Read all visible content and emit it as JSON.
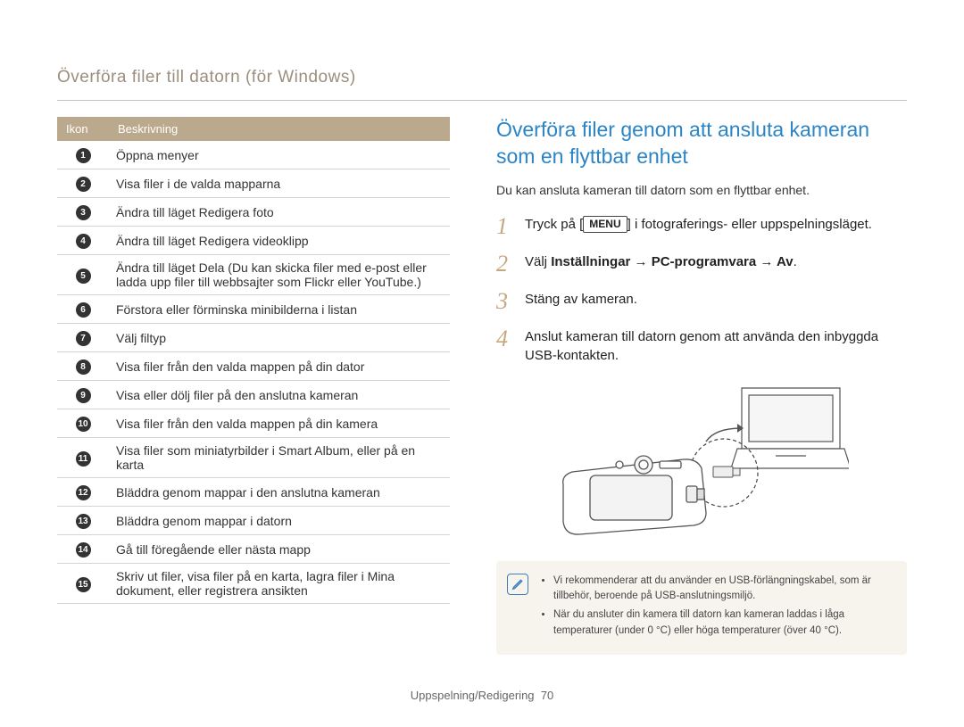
{
  "breadcrumb": "Överföra filer till datorn (för Windows)",
  "table": {
    "headers": {
      "icon": "Ikon",
      "desc": "Beskrivning"
    },
    "rows": [
      {
        "n": "1",
        "desc": "Öppna menyer"
      },
      {
        "n": "2",
        "desc": "Visa filer i de valda mapparna"
      },
      {
        "n": "3",
        "desc": "Ändra till läget Redigera foto"
      },
      {
        "n": "4",
        "desc": "Ändra till läget Redigera videoklipp"
      },
      {
        "n": "5",
        "desc": "Ändra till läget Dela (Du kan skicka filer med e-post eller ladda upp filer till webbsajter som Flickr eller YouTube.)"
      },
      {
        "n": "6",
        "desc": "Förstora eller förminska minibilderna i listan"
      },
      {
        "n": "7",
        "desc": "Välj filtyp"
      },
      {
        "n": "8",
        "desc": "Visa filer från den valda mappen på din dator"
      },
      {
        "n": "9",
        "desc": "Visa eller dölj filer på den anslutna kameran"
      },
      {
        "n": "10",
        "desc": "Visa filer från den valda mappen på din kamera"
      },
      {
        "n": "11",
        "desc": "Visa filer som miniatyrbilder i Smart Album, eller på en karta"
      },
      {
        "n": "12",
        "desc": "Bläddra genom mappar i den anslutna kameran"
      },
      {
        "n": "13",
        "desc": "Bläddra genom mappar i datorn"
      },
      {
        "n": "14",
        "desc": "Gå till föregående eller nästa mapp"
      },
      {
        "n": "15",
        "desc": "Skriv ut filer, visa filer på en karta, lagra filer i Mina dokument, eller registrera ansikten"
      }
    ]
  },
  "section_title": "Överföra filer genom att ansluta kameran som en flyttbar enhet",
  "intro": "Du kan ansluta kameran till datorn som en flyttbar enhet.",
  "steps": [
    {
      "n": "1",
      "pre": "Tryck på [",
      "menu": "MENU",
      "post": "] i fotograferings- eller uppspelningsläget."
    },
    {
      "n": "2",
      "pre": "Välj ",
      "bold": "Inställningar → PC-programvara → Av",
      "post": "."
    },
    {
      "n": "3",
      "plain": "Stäng av kameran."
    },
    {
      "n": "4",
      "plain": "Anslut kameran till datorn genom att använda den inbyggda USB-kontakten."
    }
  ],
  "note": {
    "bullets": [
      "Vi rekommenderar att du använder en USB-förlängningskabel, som är tillbehör, beroende på USB-anslutningsmiljö.",
      "När du ansluter din kamera till datorn kan kameran laddas i låga temperaturer (under 0 °C) eller höga temperaturer (över 40 °C)."
    ]
  },
  "footer": {
    "label": "Uppspelning/Redigering",
    "page": "70"
  }
}
